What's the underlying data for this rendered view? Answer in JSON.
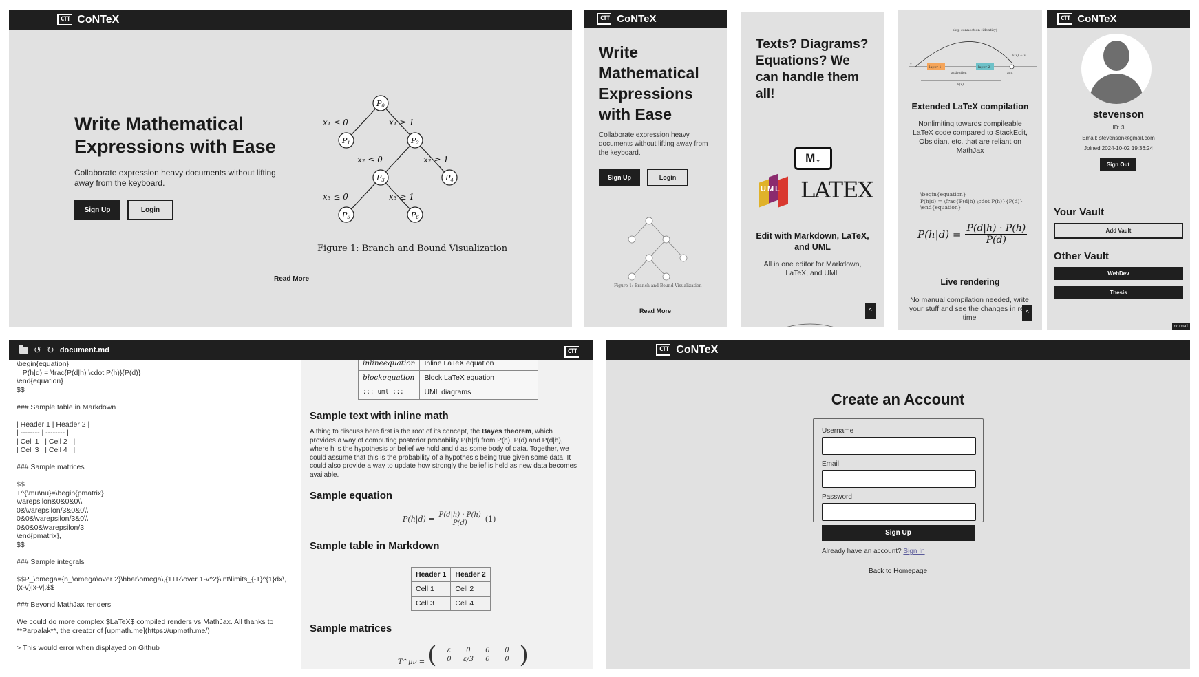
{
  "brand": {
    "name": "CoNTeX",
    "mark": "CTT"
  },
  "landing": {
    "title": "Write Mathematical Expressions with Ease",
    "subtitle": "Collaborate expression heavy documents without lifting away from the keyboard.",
    "signup": "Sign Up",
    "login": "Login",
    "read_more": "Read More",
    "figure_caption": "Figure 1: Branch and Bound Visualization",
    "tree": {
      "nodes": [
        "P0",
        "P1",
        "P2",
        "P3",
        "P4",
        "P5",
        "P6"
      ],
      "edges": [
        "x₁ ≤ 0",
        "x₁ ≥ 1",
        "x₂ ≤ 0",
        "x₂ ≥ 1",
        "x₃ ≤ 0",
        "x₃ ≥ 1"
      ]
    }
  },
  "mobile_landing": {
    "title": "Write Mathematical Expressions with Ease",
    "subtitle": "Collaborate expression heavy documents without lifting away from the keyboard.",
    "signup": "Sign Up",
    "login": "Login",
    "read_more": "Read More",
    "figure_caption": "Figure 1: Branch and Bound Visualization"
  },
  "features": {
    "headline": "Texts? Diagrams? Equations? We can handle them all!",
    "md_badge": "M↓",
    "uml_letters": "UML",
    "latex_badge": "LATEX",
    "edit_title": "Edit with Markdown, LaTeX, and UML",
    "edit_desc": "All in one editor for Markdown, LaTeX, and UML",
    "scroll_top": "^"
  },
  "compile": {
    "diagram_labels": {
      "skip": "skip connection (identity)",
      "layer1": "layer 1",
      "layer2": "layer 2",
      "activation": "activation",
      "fx": "F(x)",
      "out": "F(x) + x",
      "x": "x",
      "add": "add"
    },
    "extended_title": "Extended LaTeX compilation",
    "extended_desc": "Nonlimiting towards compileable LaTeX code compared to StackEdit, Obsidian, etc. that are reliant on MathJax",
    "latex_src": "\\begin{equation}\nP(h|d) = \\frac{P(d|h) \\cdot P(h)}{P(d)}\n\\end{equation}",
    "live_title": "Live rendering",
    "live_desc": "No manual compilation needed, write your stuff and see the changes in real time",
    "scroll_top": "^"
  },
  "profile": {
    "username": "stevenson",
    "id": "ID: 3",
    "email": "Email: stevenson@gmail.com",
    "joined": "Joined 2024-10-02 19:36:24",
    "signout": "Sign Out",
    "your_vault": "Your Vault",
    "add_vault": "Add Vault",
    "other_vault": "Other Vault",
    "vaults": [
      "WebDev",
      "Thesis"
    ],
    "corner_tag": "normal"
  },
  "editor": {
    "filename": "document.md",
    "source_lines": [
      "\\begin{equation}",
      "   P(h|d) = \\frac{P(d|h) \\cdot P(h)}{P(d)}",
      "\\end{equation}",
      "$$",
      "",
      "### Sample table in Markdown",
      "",
      "| Header 1 | Header 2 |",
      "| -------- | -------- |",
      "| Cell 1   | Cell 2   |",
      "| Cell 3   | Cell 4   |",
      "",
      "### Sample matrices",
      "",
      "$$",
      "T^{\\mu\\nu}=\\begin{pmatrix}",
      "\\varepsilon&0&0&0\\\\",
      "0&\\varepsilon/3&0&0\\\\",
      "0&0&\\varepsilon/3&0\\\\",
      "0&0&0&\\varepsilon/3",
      "\\end{pmatrix},",
      "$$",
      "",
      "### Sample integrals",
      "",
      "$$P_\\omega={n_\\omega\\over 2}\\hbar\\omega\\,{1+R\\over 1-v^2}\\int\\limits_{-1}^{1}dx\\,",
      "(x-v)|x-v|,$$",
      "",
      "### Beyond MathJax renders",
      "",
      "We could do more complex $LaTeX$ compiled renders vs MathJax. All thanks to",
      "**Parpalak**, the creator of [upmath.me](https://upmath.me/)",
      "",
      "> This would error when displayed on Github"
    ],
    "preview": {
      "syntax_table": [
        [
          "inlineequation",
          "Inline LaTeX equation"
        ],
        [
          "blockequation",
          "Block LaTeX equation"
        ],
        [
          "::: uml :::",
          "UML diagrams"
        ]
      ],
      "h_inline": "Sample text with inline math",
      "para_1": "A thing to discuss here first is the root of its concept, the",
      "para_bold": "Bayes theorem",
      "para_2": ", which provides a way of computing posterior probability P(h|d) from P(h), P(d) and P(d|h), where h is the hypothesis or belief we hold and d as some body of data. Together, we could assume that this is the probability of a hypothesis being true given some data. It could also provide a way to update how strongly the belief is held as new data becomes available.",
      "h_equation": "Sample equation",
      "equation_lhs": "P(h|d) =",
      "equation_num": "P(d|h) · P(h)",
      "equation_den": "P(d)",
      "equation_tag": "(1)",
      "h_table": "Sample table in Markdown",
      "table_headers": [
        "Header 1",
        "Header 2"
      ],
      "table_rows": [
        [
          "Cell 1",
          "Cell 2"
        ],
        [
          "Cell 3",
          "Cell 4"
        ]
      ],
      "h_matrices": "Sample matrices",
      "matrix_lhs": "T^μν =",
      "matrix_rows": [
        [
          "ε",
          "0",
          "0",
          "0"
        ],
        [
          "0",
          "ε/3",
          "0",
          "0"
        ]
      ]
    }
  },
  "register": {
    "title": "Create an Account",
    "username_label": "Username",
    "email_label": "Email",
    "password_label": "Password",
    "signup": "Sign Up",
    "have_account": "Already have an account?",
    "signin": "Sign In",
    "back": "Back to Homepage"
  }
}
